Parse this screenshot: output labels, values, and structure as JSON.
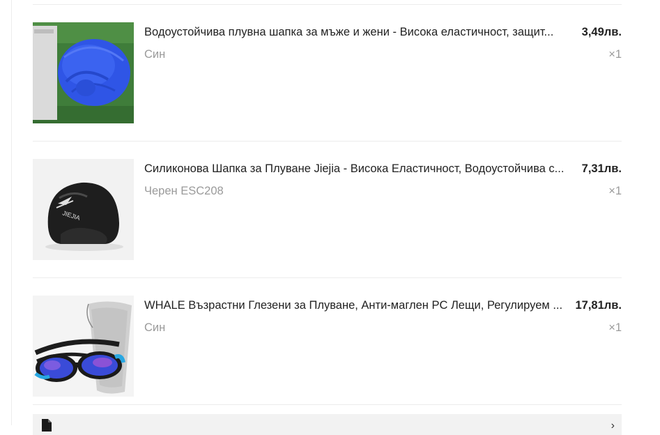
{
  "order_items": [
    {
      "title": "Водоустойчива плувна шапка за мъже и жени - Висока еластичност, защит...",
      "price": "3,49лв.",
      "variant": "Син",
      "quantity": "×1",
      "image_icon": "blue-swim-cap-image"
    },
    {
      "title": "Силиконова Шапка за Плуване Jiejia - Висока Еластичност, Водоустойчива с...",
      "price": "7,31лв.",
      "variant": "Черен ESC208",
      "quantity": "×1",
      "image_icon": "black-swim-cap-image"
    },
    {
      "title": "WHALE Възрастни Глезени за Плуване, Анти-маглен PC Лещи, Регулируем ...",
      "price": "17,81лв.",
      "variant": "Син",
      "quantity": "×1",
      "image_icon": "swim-goggles-image"
    }
  ],
  "bottom_bar": {
    "label": "",
    "icon": "document-icon",
    "chevron": "›"
  }
}
